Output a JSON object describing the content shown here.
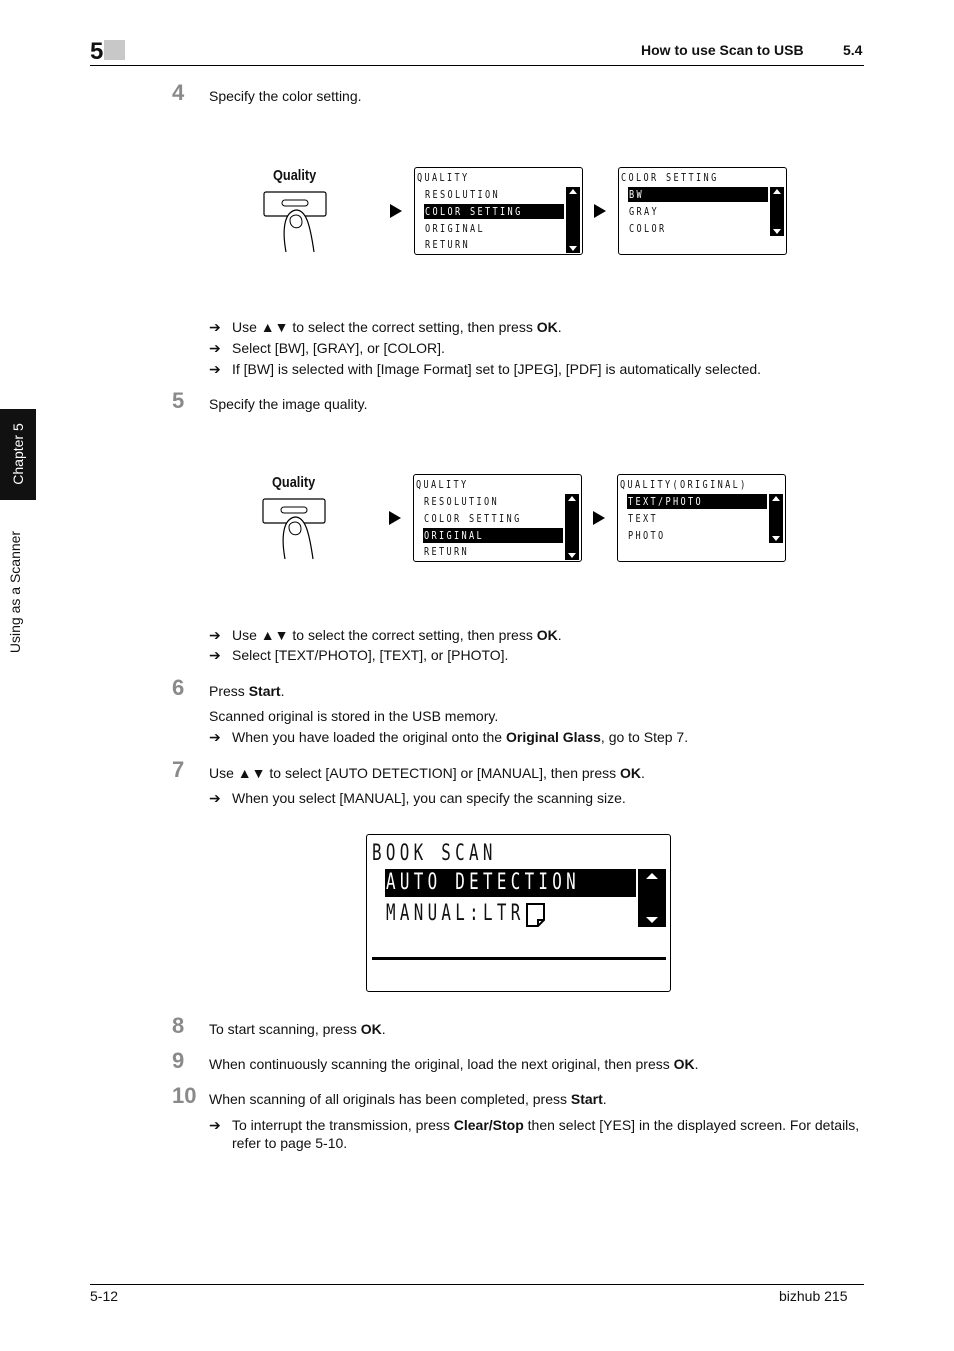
{
  "header": {
    "chapter_number": "5",
    "section_title": "How to use Scan to USB",
    "section_number": "5.4"
  },
  "side_tab": {
    "chapter_label": "Chapter 5",
    "chapter_title": "Using as a Scanner"
  },
  "steps": [
    {
      "number": "4",
      "text": "Specify the color setting.",
      "figure": {
        "button_label": "Quality",
        "screen1": {
          "title": "QUALITY",
          "items": [
            "RESOLUTION",
            "COLOR SETTING",
            "ORIGINAL",
            "RETURN"
          ],
          "selected": "COLOR SETTING"
        },
        "screen2": {
          "title": "COLOR SETTING",
          "items": [
            "BW",
            "GRAY",
            "COLOR"
          ],
          "selected": "BW"
        }
      },
      "bullets": [
        {
          "pre": "Use ▲▼ to select the correct setting, then press ",
          "bold": "OK",
          "post": "."
        },
        {
          "pre": "Select [BW], [GRAY], or [COLOR].",
          "bold": "",
          "post": ""
        },
        {
          "pre": "If [BW] is selected with [Image Format] set to [JPEG], [PDF] is automatically selected.",
          "bold": "",
          "post": ""
        }
      ]
    },
    {
      "number": "5",
      "text": "Specify the image quality.",
      "figure": {
        "button_label": "Quality",
        "screen1": {
          "title": "QUALITY",
          "items": [
            "RESOLUTION",
            "COLOR SETTING",
            "ORIGINAL",
            "RETURN"
          ],
          "selected": "ORIGINAL"
        },
        "screen2": {
          "title": "QUALITY(ORIGINAL)",
          "items": [
            "TEXT/PHOTO",
            "TEXT",
            "PHOTO"
          ],
          "selected": "TEXT/PHOTO"
        }
      },
      "bullets": [
        {
          "pre": "Use ▲▼ to select the correct setting, then press ",
          "bold": "OK",
          "post": "."
        },
        {
          "pre": "Select [TEXT/PHOTO], [TEXT], or [PHOTO].",
          "bold": "",
          "post": ""
        }
      ]
    },
    {
      "number": "6",
      "text_pre": "Press ",
      "text_bold": "Start",
      "text_post": ".",
      "subtext": "Scanned original is stored in the USB memory.",
      "bullets": [
        {
          "pre": "When you have loaded the original onto the ",
          "bold": "Original Glass",
          "post": ", go to Step 7."
        }
      ]
    },
    {
      "number": "7",
      "text_pre": "Use ▲▼ to select [AUTO DETECTION] or [MANUAL], then press ",
      "text_bold": "OK",
      "text_post": ".",
      "bullets": [
        {
          "pre": "When you select [MANUAL], you can specify the scanning size.",
          "bold": "",
          "post": ""
        }
      ],
      "figure": {
        "title": "BOOK SCAN",
        "items": [
          "AUTO DETECTION",
          "MANUAL:LTR"
        ],
        "selected": "AUTO DETECTION"
      }
    },
    {
      "number": "8",
      "text_pre": "To start scanning, press ",
      "text_bold": "OK",
      "text_post": "."
    },
    {
      "number": "9",
      "text_pre": "When continuously scanning the original, load the next original, then press ",
      "text_bold": "OK",
      "text_post": "."
    },
    {
      "number": "10",
      "text_pre": "When scanning of all originals has been completed, press ",
      "text_bold": "Start",
      "text_post": ".",
      "bullets": [
        {
          "pre": "To interrupt the transmission, press ",
          "bold": "Clear/Stop",
          "post": " then select [YES] in the displayed screen. For details, refer to page 5-10."
        }
      ]
    }
  ],
  "arrow_glyph": "➔",
  "footer": {
    "page": "5-12",
    "product": "bizhub 215"
  }
}
